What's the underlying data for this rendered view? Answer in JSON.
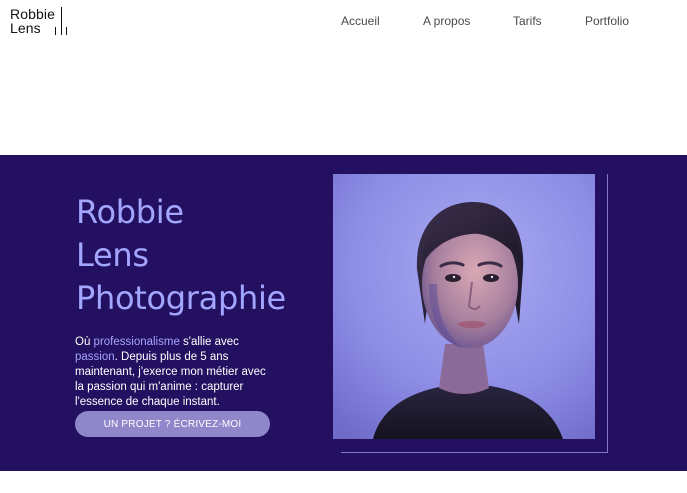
{
  "brand": {
    "line1": "Robbie",
    "line2": "Lens"
  },
  "nav": {
    "items": [
      {
        "label": "Accueil"
      },
      {
        "label": "A propos"
      },
      {
        "label": "Tarifs"
      },
      {
        "label": "Portfolio"
      }
    ]
  },
  "hero": {
    "title_lines": [
      "Robbie",
      "Lens",
      "Photographie"
    ],
    "desc": {
      "p1": "Où ",
      "h1": "professionalisme",
      "p2": " s'allie avec ",
      "h2": "passion",
      "p3": ". Depuis plus de 5 ans maintenant, j'exerce mon métier avec la passion qui m'anime : capturer l'essence de chaque instant."
    },
    "cta_label": "UN PROJET ? ÉCRIVEZ-MOI"
  },
  "colors": {
    "hero_bg": "#241060",
    "accent": "#a3a6ff",
    "cta_bg": "#8f87c9"
  },
  "icons": [
    "logo-bars-icon"
  ]
}
